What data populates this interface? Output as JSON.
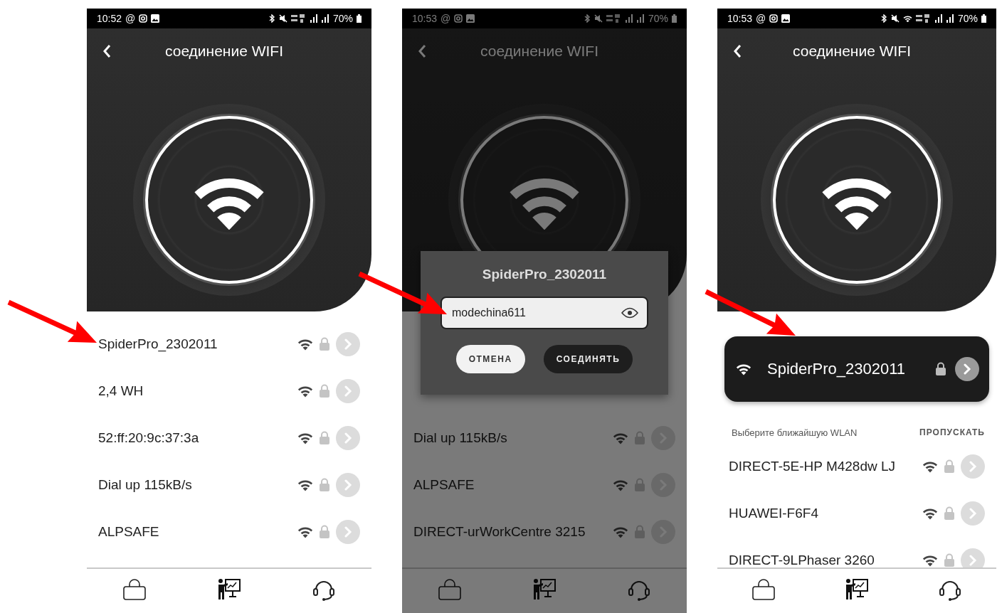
{
  "screens": [
    {
      "status_bar": {
        "time": "10:52",
        "at_sign": "@",
        "wifi_connected": false,
        "battery": "70%"
      },
      "title": "соединение WIFI",
      "dimmed": false,
      "networks": [
        {
          "name": "SpiderPro_2302011"
        },
        {
          "name": "2,4 WH"
        },
        {
          "name": "52:ff:20:9c:37:3a"
        },
        {
          "name": "Dial up 115kB/s"
        },
        {
          "name": "ALPSAFE"
        }
      ]
    },
    {
      "status_bar": {
        "time": "10:53",
        "at_sign": "@",
        "wifi_connected": false,
        "battery": "70%"
      },
      "title": "соединение WIFI",
      "dimmed": true,
      "dialog": {
        "title": "SpiderPro_2302011",
        "password": "modechina611",
        "cancel": "ОТМЕНА",
        "confirm": "СОЕДИНЯТЬ"
      },
      "networks": [
        {
          "name": "Dial up 115kB/s"
        },
        {
          "name": "ALPSAFE"
        },
        {
          "name": "DIRECT-urWorkCentre 3215"
        }
      ]
    },
    {
      "status_bar": {
        "time": "10:53",
        "at_sign": "@",
        "wifi_connected": true,
        "battery": "70%"
      },
      "title": "соединение WIFI",
      "dimmed": false,
      "selected_network": {
        "name": "SpiderPro_2302011"
      },
      "list_header": {
        "text": "Выберите ближайшую WLAN",
        "action": "ПРОПУСКАТЬ"
      },
      "networks": [
        {
          "name": "DIRECT-5E-HP M428dw LJ"
        },
        {
          "name": "HUAWEI-F6F4"
        },
        {
          "name": "DIRECT-9LPhaser 3260"
        }
      ]
    }
  ]
}
